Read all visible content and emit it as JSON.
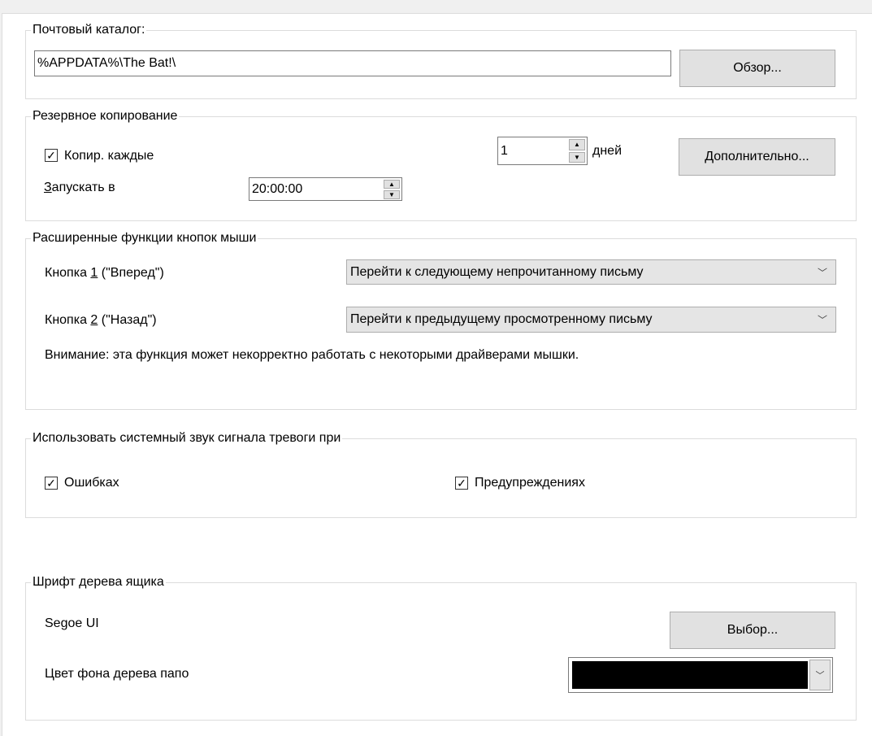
{
  "mail_dir": {
    "title": "Почтовый каталог:",
    "path": "%APPDATA%\\The Bat!\\",
    "browse": "Обзор..."
  },
  "backup": {
    "title": "Резервное копирование",
    "copy_every": "Копир. каждые",
    "copy_checked": true,
    "days_value": "1",
    "days_unit": "дней",
    "advanced": "Дополнительно...",
    "run_at_pre": "З",
    "run_at_rest": "апускать в",
    "time_value": "20:00:00"
  },
  "mouse": {
    "title": "Расширенные функции кнопок мыши",
    "btn1_pre": "Кнопка ",
    "btn1_num": "1",
    "btn1_post": " (\"Вперед\")",
    "btn1_value": "Перейти к следующему непрочитанному письму",
    "btn2_pre": "Кнопка ",
    "btn2_num": "2",
    "btn2_post": " (\"Назад\")",
    "btn2_value": "Перейти к предыдущему просмотренному письму",
    "warning": "Внимание: эта функция может некорректно работать с некоторыми драйверами мышки."
  },
  "sound": {
    "title": "Использовать системный звук сигнала тревоги при",
    "errors": "Ошибках",
    "warnings": "Предупреждениях"
  },
  "font": {
    "title": "Шрифт дерева ящика",
    "font_name": "Segoe UI",
    "choose": "Выбор...",
    "bg_label": "Цвет фона дерева папо",
    "bg_color": "#000000"
  }
}
